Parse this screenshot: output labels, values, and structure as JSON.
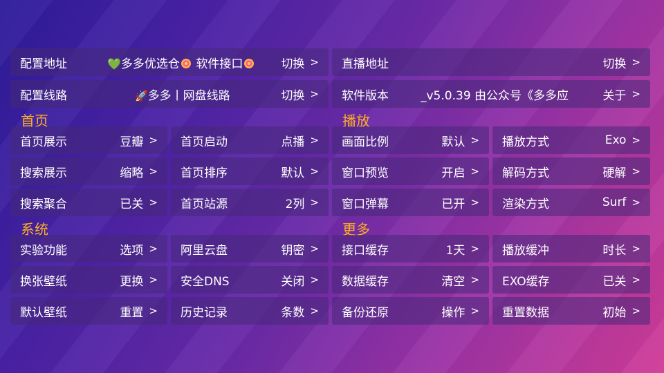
{
  "top": {
    "config_url": {
      "label": "配置地址",
      "heart": "💚",
      "text_a": "多多优选仓",
      "text_b": " 软件接口",
      "action": "切换"
    },
    "live_url": {
      "label": "直播地址",
      "action": "切换"
    },
    "config_route": {
      "label": "配置线路",
      "rocket": "🚀",
      "text": "多多丨网盘线路",
      "action": "切换"
    },
    "app_version": {
      "label": "软件版本",
      "text": "_v5.0.39 由公众号《多多应",
      "action": "关于"
    }
  },
  "sections": {
    "home": "首页",
    "play": "播放",
    "system": "系统",
    "more": "更多"
  },
  "chevron": ">",
  "home_items": [
    {
      "label": "首页展示",
      "value": "豆瓣"
    },
    {
      "label": "首页启动",
      "value": "点播"
    },
    {
      "label": "搜索展示",
      "value": "缩略"
    },
    {
      "label": "首页排序",
      "value": "默认"
    },
    {
      "label": "搜索聚合",
      "value": "已关"
    },
    {
      "label": "首页站源",
      "value": "2列"
    }
  ],
  "play_items": [
    {
      "label": "画面比例",
      "value": "默认"
    },
    {
      "label": "播放方式",
      "value": "Exo"
    },
    {
      "label": "窗口预览",
      "value": "开启"
    },
    {
      "label": "解码方式",
      "value": "硬解"
    },
    {
      "label": "窗口弹幕",
      "value": "已开"
    },
    {
      "label": "渲染方式",
      "value": "Surf"
    }
  ],
  "system_items": [
    {
      "label": "实验功能",
      "value": "选项"
    },
    {
      "label": "阿里云盘",
      "value": "钥密"
    },
    {
      "label": "换张壁纸",
      "value": "更换"
    },
    {
      "label": "安全DNS",
      "value": "关闭"
    },
    {
      "label": "默认壁纸",
      "value": "重置"
    },
    {
      "label": "历史记录",
      "value": "条数"
    }
  ],
  "more_items": [
    {
      "label": "接口缓存",
      "value": "1天"
    },
    {
      "label": "播放缓冲",
      "value": "时长"
    },
    {
      "label": "数据缓存",
      "value": "清空"
    },
    {
      "label": "EXO缓存",
      "value": "已关"
    },
    {
      "label": "备份还原",
      "value": "操作"
    },
    {
      "label": "重置数据",
      "value": "初始"
    }
  ]
}
